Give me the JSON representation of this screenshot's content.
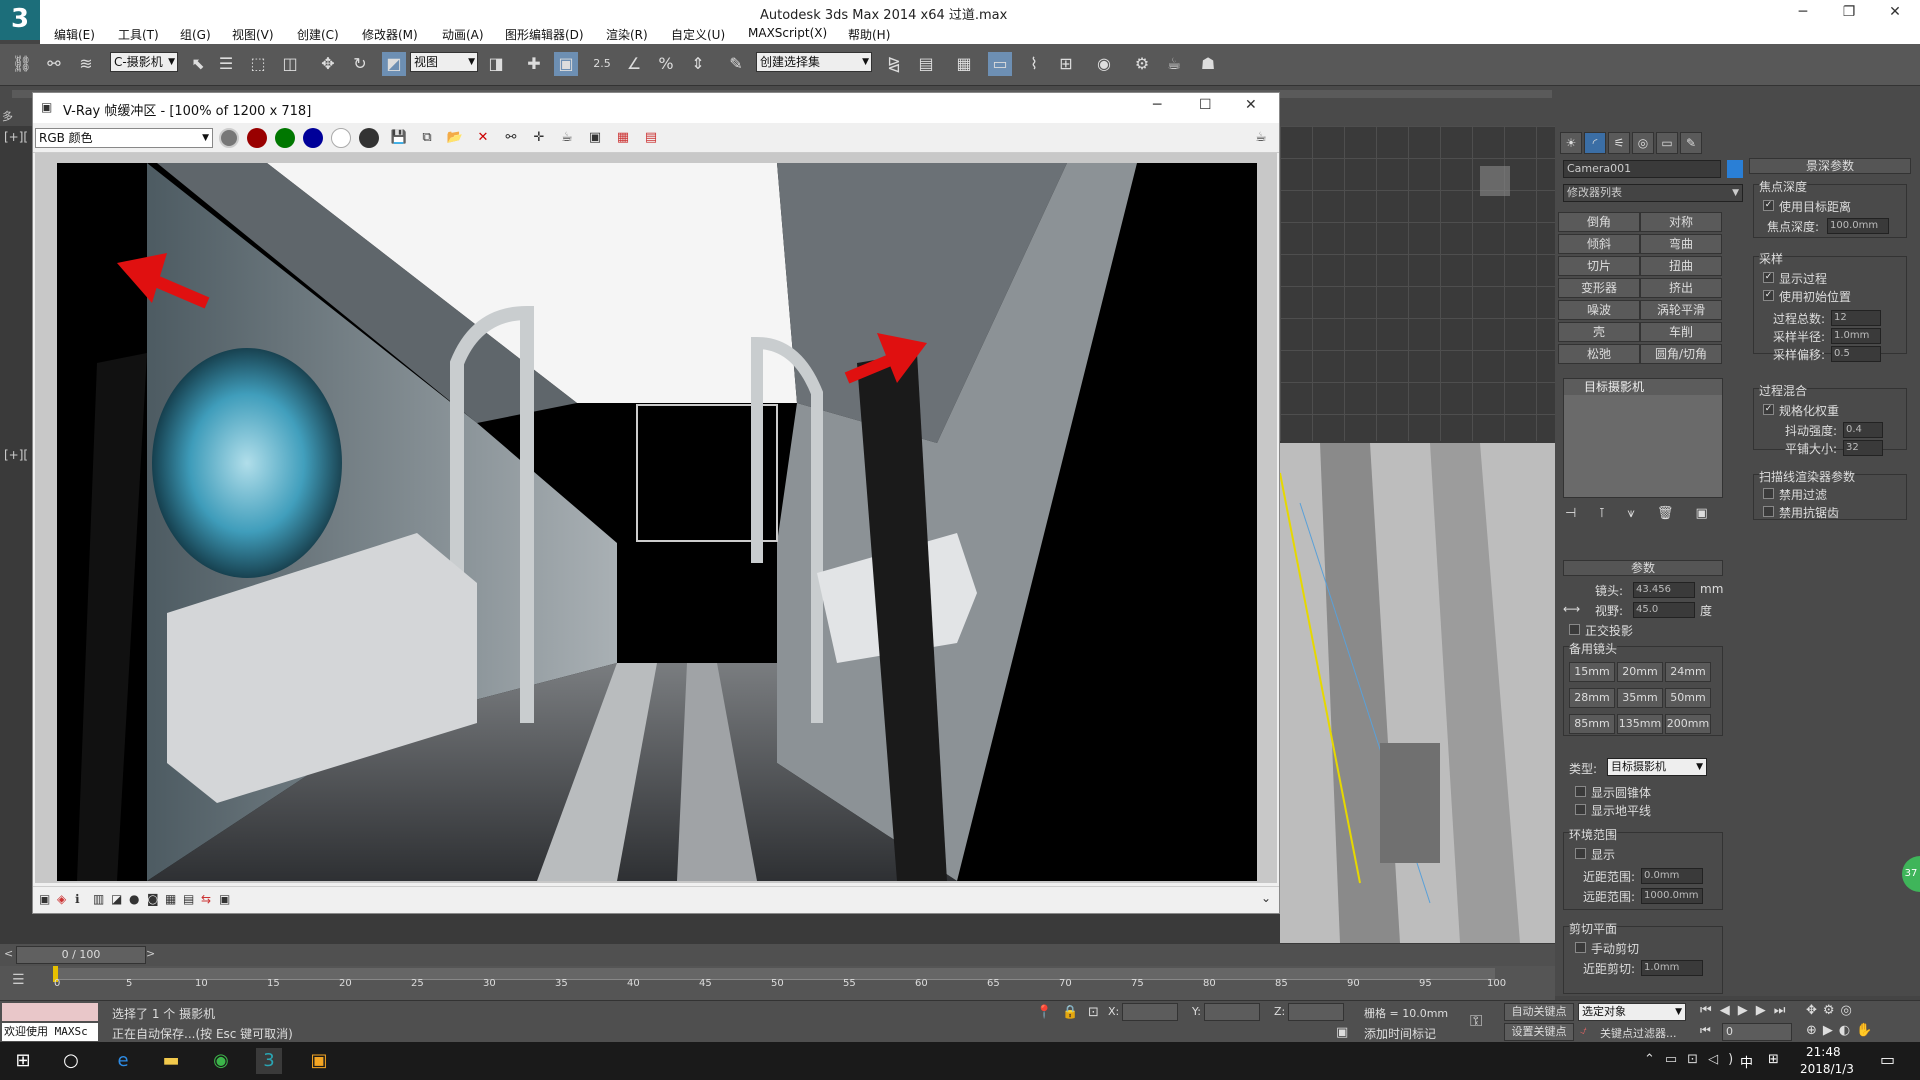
{
  "app": {
    "title": "Autodesk 3ds Max  2014 x64      过道.max",
    "logo": "3"
  },
  "menu": [
    "编辑(E)",
    "工具(T)",
    "组(G)",
    "视图(V)",
    "创建(C)",
    "修改器(M)",
    "动画(A)",
    "图形编辑器(D)",
    "渲染(R)",
    "自定义(U)",
    "MAXScript(X)",
    "帮助(H)"
  ],
  "toolbar": {
    "camera_combo": "C-摄影机",
    "view_combo": "视图",
    "num_25": "2.5",
    "selection_set": "创建选择集"
  },
  "viewports": {
    "label_top": "[+][",
    "label_bottom": "[+][",
    "side_label": "多"
  },
  "vray": {
    "title": "V-Ray 帧缓冲区 - [100% of 1200 x 718]",
    "channel": "RGB 颜色"
  },
  "command_panel": {
    "object_name": "Camera001",
    "modifier_list": "修改器列表",
    "modifiers": [
      [
        "倒角",
        "对称"
      ],
      [
        "倾斜",
        "弯曲"
      ],
      [
        "切片",
        "扭曲"
      ],
      [
        "变形器",
        "挤出"
      ],
      [
        "噪波",
        "涡轮平滑"
      ],
      [
        "壳",
        "车削"
      ],
      [
        "松弛",
        "圆角/切角"
      ]
    ],
    "stack_item": "目标摄影机",
    "params_title": "参数",
    "lens_label": "镜头:",
    "lens_value": "43.456",
    "lens_unit": "mm",
    "fov_label": "视野:",
    "fov_value": "45.0",
    "fov_unit": "度",
    "ortho": "正交投影",
    "stock_lens": "备用镜头",
    "stock_lenses": [
      "15mm",
      "20mm",
      "24mm",
      "28mm",
      "35mm",
      "50mm",
      "85mm",
      "135mm",
      "200mm"
    ],
    "type_label": "类型:",
    "type_value": "目标摄影机",
    "show_cone": "显示圆锥体",
    "show_horizon": "显示地平线",
    "env_range": "环境范围",
    "env_show": "显示",
    "near_range_label": "近距范围:",
    "near_range": "0.0mm",
    "far_range_label": "远距范围:",
    "far_range": "1000.0mm",
    "clip_title": "剪切平面",
    "manual_clip": "手动剪切",
    "near_clip_label": "近距剪切:",
    "near_clip": "1.0mm"
  },
  "dof_panel": {
    "title": "景深参数",
    "focal_depth_group": "焦点深度",
    "use_target": "使用目标距离",
    "focal_depth_label": "焦点深度:",
    "focal_depth": "100.0mm",
    "sampling_group": "采样",
    "show_passes": "显示过程",
    "use_initial": "使用初始位置",
    "total_passes_label": "过程总数:",
    "total_passes": "12",
    "sample_radius_label": "采样半径:",
    "sample_radius": "1.0mm",
    "sample_bias_label": "采样偏移:",
    "sample_bias": "0.5",
    "blend_group": "过程混合",
    "normalize": "规格化权重",
    "dither_label": "抖动强度:",
    "dither": "0.4",
    "tile_label": "平铺大小:",
    "tile": "32",
    "scanline_group": "扫描线渲染器参数",
    "disable_filter": "禁用过滤",
    "disable_aa": "禁用抗锯齿"
  },
  "timeline": {
    "frame": "0 / 100",
    "ticks": [
      "0",
      "5",
      "10",
      "15",
      "20",
      "25",
      "30",
      "35",
      "40",
      "45",
      "50",
      "55",
      "60",
      "65",
      "70",
      "75",
      "80",
      "85",
      "90",
      "95",
      "100"
    ]
  },
  "status": {
    "welcome": "欢迎使用 MAXSc",
    "selected": "选择了 1 个 摄影机",
    "autosave": "正在自动保存...(按 Esc 键可取消)",
    "x_label": "X:",
    "y_label": "Y:",
    "z_label": "Z:",
    "grid": "栅格 = 10.0mm",
    "add_time_tag": "添加时间标记",
    "auto_key": "自动关键点",
    "selection": "选定对象",
    "set_key": "设置关键点",
    "key_filters": "关键点过滤器...",
    "frame_field": "0"
  },
  "taskbar": {
    "time": "21:48",
    "date": "2018/1/3",
    "ime": "中",
    "badge": "37"
  },
  "colors": {
    "accent": "#1c6e7a",
    "arrow": "#e01010",
    "panel": "#4a4a4a"
  }
}
